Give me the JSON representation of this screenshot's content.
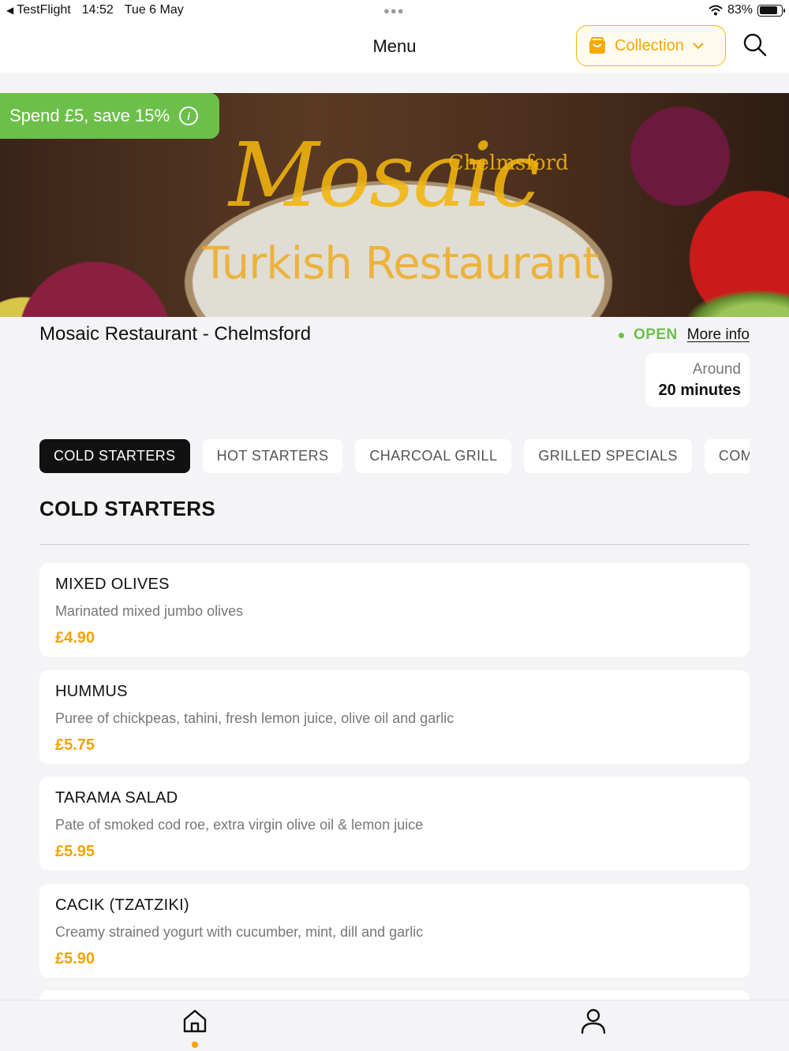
{
  "status_bar": {
    "app": "TestFlight",
    "time": "14:52",
    "date": "Tue 6 May",
    "battery": "83%"
  },
  "header": {
    "title": "Menu",
    "collection_label": "Collection"
  },
  "banner": {
    "promo": "Spend £5, save 15%",
    "logo_location": "Chelmsford",
    "logo_name": "Mosaic",
    "logo_subtitle": "Turkish Restaurant"
  },
  "restaurant": {
    "name": "Mosaic Restaurant - Chelmsford",
    "status": "OPEN",
    "more_info": "More info",
    "eta_prefix": "Around",
    "eta_value": "20 minutes"
  },
  "tabs": [
    {
      "label": "COLD STARTERS",
      "active": true
    },
    {
      "label": "HOT STARTERS",
      "active": false
    },
    {
      "label": "CHARCOAL GRILL",
      "active": false
    },
    {
      "label": "GRILLED SPECIALS",
      "active": false
    },
    {
      "label": "COMBINATIONS",
      "active": false
    }
  ],
  "section": {
    "title": "COLD STARTERS"
  },
  "items": [
    {
      "name": "MIXED OLIVES",
      "description": "Marinated mixed jumbo olives",
      "price": "£4.90"
    },
    {
      "name": "HUMMUS",
      "description": "Puree of chickpeas, tahini, fresh lemon juice, olive oil and garlic",
      "price": "£5.75"
    },
    {
      "name": "TARAMA SALAD",
      "description": "Pate of smoked cod roe, extra virgin olive oil & lemon juice",
      "price": "£5.95"
    },
    {
      "name": "CACIK (TZATZIKI)",
      "description": "Creamy strained yogurt with cucumber, mint, dill and garlic",
      "price": "£5.90"
    }
  ],
  "colors": {
    "accent": "#f5a300",
    "open_green": "#6cc04a",
    "active_tab": "#111111"
  },
  "icons": {
    "collection": "shopping-bag-icon",
    "search": "search-icon",
    "home": "home-icon",
    "account": "user-icon"
  }
}
